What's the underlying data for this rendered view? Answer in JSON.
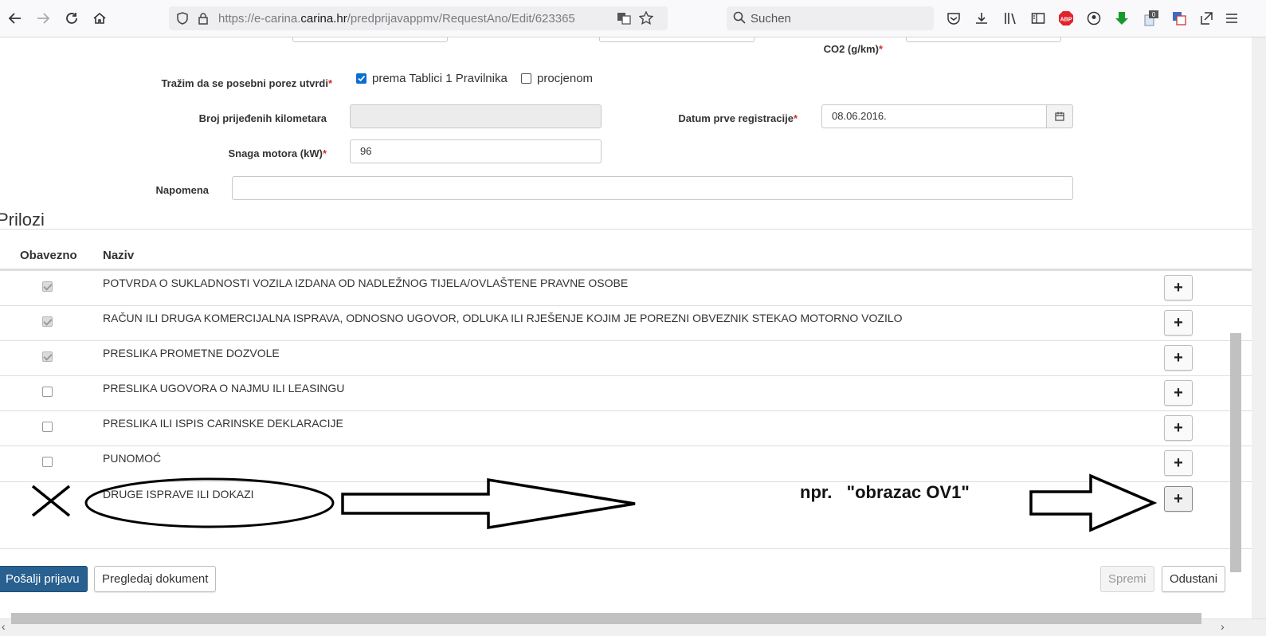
{
  "browser": {
    "url_prefix": "https://e-carina.",
    "url_domain": "carina.hr",
    "url_path": "/predprijavappmv/RequestAno/Edit/623365",
    "search_placeholder": "Suchen",
    "abp_label": "ABP",
    "badge_count": "0",
    "icons": [
      "back-icon",
      "forward-icon",
      "reload-icon",
      "home-icon",
      "shield-icon",
      "lock-icon",
      "translate-icon",
      "star-icon",
      "search-icon",
      "pocket-icon",
      "download-icon",
      "library-icon",
      "sidebar-icon",
      "adblock-icon",
      "account-icon",
      "green-download-icon",
      "extension-icon",
      "translate-icon",
      "share-icon",
      "menu-icon"
    ]
  },
  "form": {
    "co2_label": "CO2 (g/km)",
    "porez_label": "Tražim da se posebni porez utvrdi",
    "option_tablica": "prema Tablici 1 Pravilnika",
    "option_tablica_checked": true,
    "option_procjena": "procjenom",
    "option_procjena_checked": false,
    "km_label": "Broj prijeđenih kilometara",
    "km_value": "",
    "datum_label": "Datum prve registracije",
    "datum_value": "08.06.2016.",
    "snaga_label": "Snaga motora (kW)",
    "snaga_value": "96",
    "napomena_label": "Napomena",
    "napomena_value": "",
    "required_mark": "*"
  },
  "prilozi": {
    "title": "Prilozi",
    "col_obavezno": "Obavezno",
    "col_naziv": "Naziv",
    "add_label": "+",
    "rows": [
      {
        "naziv": "POTVRDA O SUKLADNOSTI VOZILA IZDANA OD NADLEŽNOG TIJELA/OVLAŠTENE PRAVNE OSOBE",
        "obavezno": true
      },
      {
        "naziv": "RAČUN ILI DRUGA KOMERCIJALNA ISPRAVA, ODNOSNO UGOVOR, ODLUKA ILI RJEŠENJE KOJIM JE POREZNI OBVEZNIK STEKAO MOTORNO VOZILO",
        "obavezno": true
      },
      {
        "naziv": "PRESLIKA PROMETNE DOZVOLE",
        "obavezno": true
      },
      {
        "naziv": "PRESLIKA UGOVORA O NAJMU ILI LEASINGU",
        "obavezno": false
      },
      {
        "naziv": "PRESLIKA ILI ISPIS CARINSKE DEKLARACIJE",
        "obavezno": false
      },
      {
        "naziv": "PUNOMOĆ",
        "obavezno": false
      },
      {
        "naziv": "DRUGE ISPRAVE ILI DOKAZI",
        "obavezno": false
      }
    ]
  },
  "annotation": {
    "text": "npr.   \"obrazac OV1\""
  },
  "actions": {
    "posalji": "Pošalji prijavu",
    "pregledaj": "Pregledaj dokument",
    "spremi": "Spremi",
    "odustani": "Odustani"
  }
}
